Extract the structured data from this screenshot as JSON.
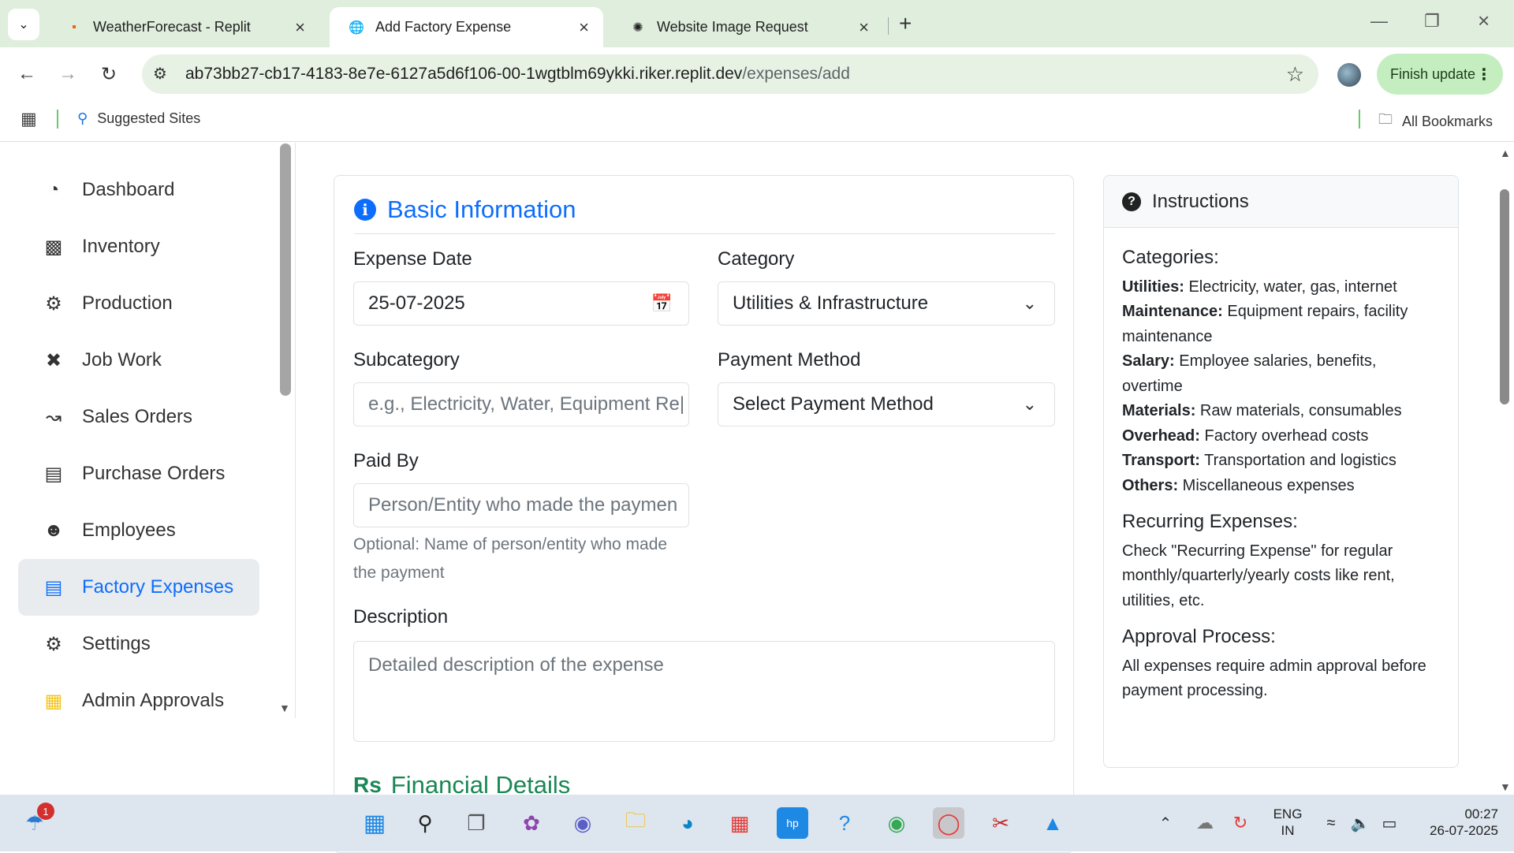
{
  "browser": {
    "tabs": [
      {
        "title": "WeatherForecast - Replit",
        "icon": "replit-icon"
      },
      {
        "title": "Add Factory Expense",
        "icon": "globe-icon"
      },
      {
        "title": "Website Image Request",
        "icon": "openai-icon"
      }
    ],
    "url_host": "ab73bb27-cb17-4183-8e7e-6127a5d6f106-00-1wgtblm69ykki.riker.replit.dev",
    "url_path": "/expenses/add",
    "finish_update_label": "Finish update",
    "bookmarks": {
      "suggested": "Suggested Sites",
      "all": "All Bookmarks"
    }
  },
  "sidebar": {
    "items": [
      {
        "label": "Dashboard",
        "icon": "gauge-icon"
      },
      {
        "label": "Inventory",
        "icon": "boxes-icon"
      },
      {
        "label": "Production",
        "icon": "cogs-icon"
      },
      {
        "label": "Job Work",
        "icon": "tools-icon"
      },
      {
        "label": "Sales Orders",
        "icon": "chart-line-icon"
      },
      {
        "label": "Purchase Orders",
        "icon": "file-invoice-icon"
      },
      {
        "label": "Employees",
        "icon": "users-icon"
      },
      {
        "label": "Factory Expenses",
        "icon": "receipt-icon",
        "active": true
      },
      {
        "label": "Settings",
        "icon": "cog-icon"
      },
      {
        "label": "Admin Approvals",
        "icon": "clipboard-check-icon"
      }
    ]
  },
  "form": {
    "section_title": "Basic Information",
    "expense_date": {
      "label": "Expense Date",
      "value": "25-07-2025"
    },
    "category": {
      "label": "Category",
      "value": "Utilities & Infrastructure"
    },
    "subcategory": {
      "label": "Subcategory",
      "placeholder": "e.g., Electricity, Water, Equipment Re|"
    },
    "payment_method": {
      "label": "Payment Method",
      "value": "Select Payment Method"
    },
    "paid_by": {
      "label": "Paid By",
      "placeholder": "Person/Entity who made the paymen",
      "help": "Optional: Name of person/entity who made the payment"
    },
    "description": {
      "label": "Description",
      "placeholder": "Detailed description of the expense"
    },
    "financial_title": "Financial Details",
    "currency_symbol": "Rs"
  },
  "instructions": {
    "title": "Instructions",
    "categories_heading": "Categories:",
    "categories": [
      {
        "name": "Utilities:",
        "desc": " Electricity, water, gas, internet"
      },
      {
        "name": "Maintenance:",
        "desc": " Equipment repairs, facility maintenance"
      },
      {
        "name": "Salary:",
        "desc": " Employee salaries, benefits, overtime"
      },
      {
        "name": "Materials:",
        "desc": " Raw materials, consumables"
      },
      {
        "name": "Overhead:",
        "desc": " Factory overhead costs"
      },
      {
        "name": "Transport:",
        "desc": " Transportation and logistics"
      },
      {
        "name": "Others:",
        "desc": " Miscellaneous expenses"
      }
    ],
    "recurring_heading": "Recurring Expenses:",
    "recurring_text": "Check \"Recurring Expense\" for regular monthly/quarterly/yearly costs like rent, utilities, etc.",
    "approval_heading": "Approval Process:",
    "approval_text": "All expenses require admin approval before payment processing."
  },
  "taskbar": {
    "notification_count": "1",
    "language": "ENG",
    "region": "IN",
    "time": "00:27",
    "date": "26-07-2025"
  },
  "colors": {
    "primary": "#0d6efd",
    "success": "#198754",
    "tabbar": "#dfeedd"
  }
}
